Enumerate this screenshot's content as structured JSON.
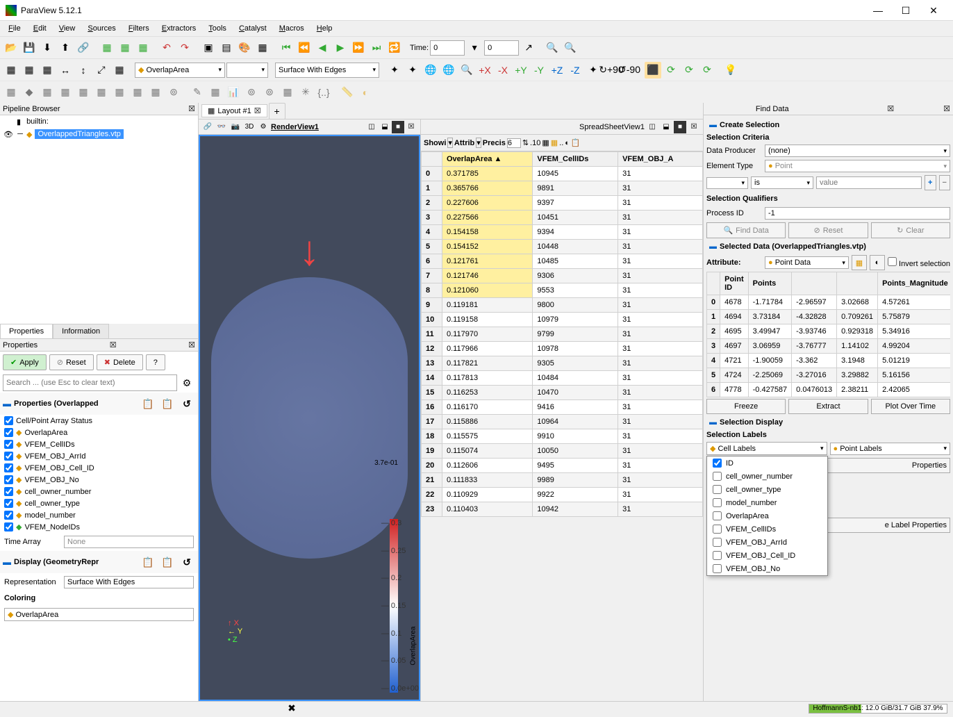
{
  "window": {
    "title": "ParaView 5.12.1"
  },
  "menu": [
    "File",
    "Edit",
    "View",
    "Sources",
    "Filters",
    "Extractors",
    "Tools",
    "Catalyst",
    "Macros",
    "Help"
  ],
  "toolbar2": {
    "coloring_field": "OverlapArea",
    "representation": "Surface With Edges",
    "time_label": "Time:",
    "time_value": "0",
    "time_index": "0"
  },
  "pipeline": {
    "title": "Pipeline Browser",
    "root": "builtin:",
    "item": "OverlappedTriangles.vtp"
  },
  "properties_panel": {
    "tab_properties": "Properties",
    "tab_information": "Information",
    "header": "Properties",
    "apply": "Apply",
    "reset": "Reset",
    "delete": "Delete",
    "help": "?",
    "search_placeholder": "Search ... (use Esc to clear text)",
    "section_props": "Properties (Overlapped",
    "array_status": "Cell/Point Array Status",
    "arrays": [
      "OverlapArea",
      "VFEM_CellIDs",
      "VFEM_OBJ_ArrId",
      "VFEM_OBJ_Cell_ID",
      "VFEM_OBJ_No",
      "cell_owner_number",
      "cell_owner_type",
      "model_number",
      "VFEM_NodeIDs"
    ],
    "time_array_label": "Time Array",
    "time_array_value": "None",
    "section_display": "Display (GeometryRepr",
    "repr_label": "Representation",
    "repr_value": "Surface With Edges",
    "coloring_label": "Coloring",
    "coloring_value": "OverlapArea"
  },
  "layout": {
    "tab": "Layout #1"
  },
  "render_view": {
    "name": "RenderView1",
    "mode_3d": "3D",
    "colorbar_title": "OverlapArea",
    "colorbar_max": "3.7e-01",
    "ticks": [
      "0.3",
      "0.25",
      "0.2",
      "0.15",
      "0.1",
      "0.05",
      "0.0e+00"
    ],
    "axes": [
      "X",
      "Y",
      "Z"
    ]
  },
  "spreadsheet": {
    "name": "SpreadSheetView1",
    "show_label": "Showi",
    "attr_label": "Attrib",
    "prec_label": "Precis",
    "prec_value": "6",
    "columns": [
      "",
      "OverlapArea",
      "VFEM_CellIDs",
      "VFEM_OBJ_A"
    ],
    "highlight_count": 9,
    "rows": [
      [
        "0",
        "0.371785",
        "10945",
        "31"
      ],
      [
        "1",
        "0.365766",
        "9891",
        "31"
      ],
      [
        "2",
        "0.227606",
        "9397",
        "31"
      ],
      [
        "3",
        "0.227566",
        "10451",
        "31"
      ],
      [
        "4",
        "0.154158",
        "9394",
        "31"
      ],
      [
        "5",
        "0.154152",
        "10448",
        "31"
      ],
      [
        "6",
        "0.121761",
        "10485",
        "31"
      ],
      [
        "7",
        "0.121746",
        "9306",
        "31"
      ],
      [
        "8",
        "0.121060",
        "9553",
        "31"
      ],
      [
        "9",
        "0.119181",
        "9800",
        "31"
      ],
      [
        "10",
        "0.119158",
        "10979",
        "31"
      ],
      [
        "11",
        "0.117970",
        "9799",
        "31"
      ],
      [
        "12",
        "0.117966",
        "10978",
        "31"
      ],
      [
        "13",
        "0.117821",
        "9305",
        "31"
      ],
      [
        "14",
        "0.117813",
        "10484",
        "31"
      ],
      [
        "15",
        "0.116253",
        "10470",
        "31"
      ],
      [
        "16",
        "0.116170",
        "9416",
        "31"
      ],
      [
        "17",
        "0.115886",
        "10964",
        "31"
      ],
      [
        "18",
        "0.115575",
        "9910",
        "31"
      ],
      [
        "19",
        "0.115074",
        "10050",
        "31"
      ],
      [
        "20",
        "0.112606",
        "9495",
        "31"
      ],
      [
        "21",
        "0.111833",
        "9989",
        "31"
      ],
      [
        "22",
        "0.110929",
        "9922",
        "31"
      ],
      [
        "23",
        "0.110403",
        "10942",
        "31"
      ]
    ]
  },
  "find_data": {
    "title": "Find Data",
    "create_selection": "Create Selection",
    "criteria": "Selection Criteria",
    "data_producer_label": "Data Producer",
    "data_producer_value": "(none)",
    "element_type_label": "Element Type",
    "element_type_value": "Point",
    "op": "is",
    "value_placeholder": "value",
    "qualifiers": "Selection Qualifiers",
    "process_id_label": "Process ID",
    "process_id_value": "-1",
    "find_btn": "Find Data",
    "reset_btn": "Reset",
    "clear_btn": "Clear",
    "selected_data": "Selected Data (OverlappedTriangles.vtp)",
    "attribute_label": "Attribute:",
    "attribute_value": "Point Data",
    "invert": "Invert selection",
    "sel_columns": [
      "",
      "Point ID",
      "Points",
      "",
      "",
      "Points_Magnitude"
    ],
    "sel_rows": [
      [
        "0",
        "4678",
        "-1.71784",
        "-2.96597",
        "3.02668",
        "4.57261"
      ],
      [
        "1",
        "4694",
        "3.73184",
        "-4.32828",
        "0.709261",
        "5.75879"
      ],
      [
        "2",
        "4695",
        "3.49947",
        "-3.93746",
        "0.929318",
        "5.34916"
      ],
      [
        "3",
        "4697",
        "3.06959",
        "-3.76777",
        "1.14102",
        "4.99204"
      ],
      [
        "4",
        "4721",
        "-1.90059",
        "-3.362",
        "3.1948",
        "5.01219"
      ],
      [
        "5",
        "4724",
        "-2.25069",
        "-3.27016",
        "3.29882",
        "5.16156"
      ],
      [
        "6",
        "4778",
        "-0.427587",
        "0.0476013",
        "2.38211",
        "2.42065"
      ]
    ],
    "freeze": "Freeze",
    "extract": "Extract",
    "plot_over_time": "Plot Over Time",
    "selection_display": "Selection Display",
    "selection_labels": "Selection Labels",
    "cell_labels": "Cell Labels",
    "point_labels": "Point Labels",
    "label_props_suffix": "Properties",
    "label_props_end": "e Label Properties",
    "popup_items": [
      {
        "label": "ID",
        "checked": true
      },
      {
        "label": "cell_owner_number",
        "checked": false
      },
      {
        "label": "cell_owner_type",
        "checked": false
      },
      {
        "label": "model_number",
        "checked": false
      },
      {
        "label": "OverlapArea",
        "checked": false
      },
      {
        "label": "VFEM_CellIDs",
        "checked": false
      },
      {
        "label": "VFEM_OBJ_ArrId",
        "checked": false
      },
      {
        "label": "VFEM_OBJ_Cell_ID",
        "checked": false
      },
      {
        "label": "VFEM_OBJ_No",
        "checked": false
      }
    ]
  },
  "statusbar": {
    "text": "HoffmannS-nb1: 12.0 GiB/31.7 GiB 37.9%",
    "percent": 37.9
  }
}
